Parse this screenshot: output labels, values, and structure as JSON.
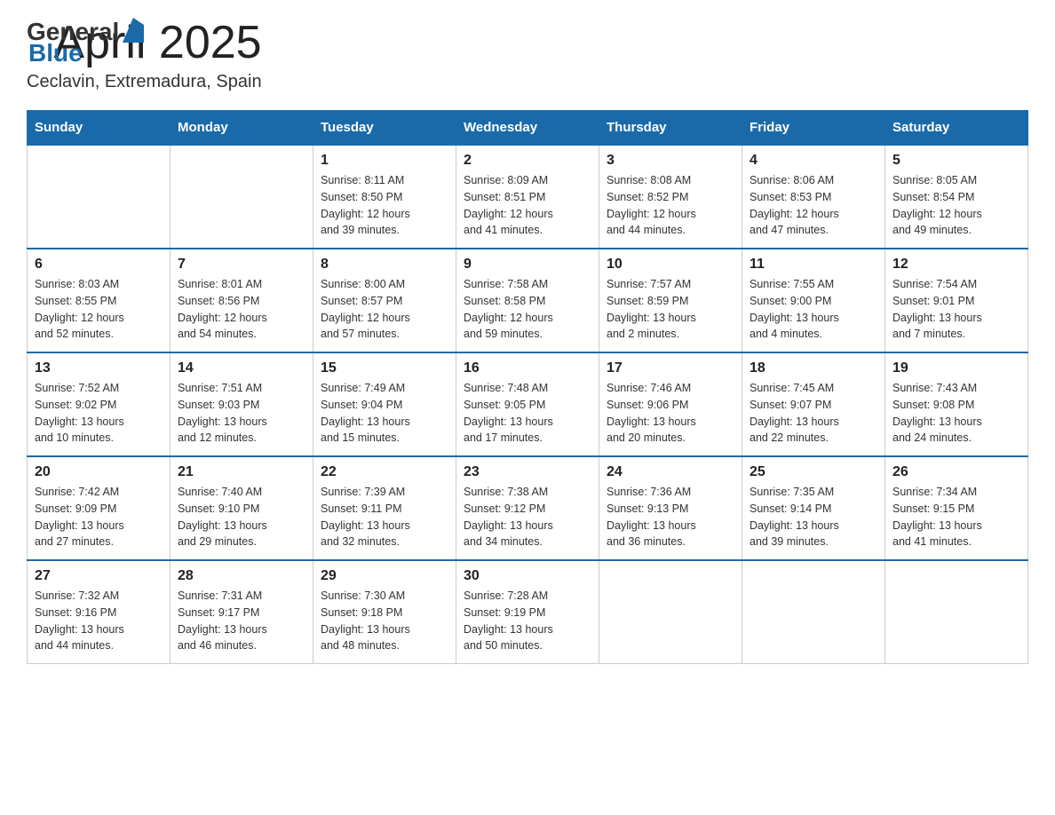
{
  "header": {
    "logo_general": "General",
    "logo_blue": "Blue",
    "month_year": "April 2025",
    "location": "Ceclavin, Extremadura, Spain"
  },
  "days_of_week": [
    "Sunday",
    "Monday",
    "Tuesday",
    "Wednesday",
    "Thursday",
    "Friday",
    "Saturday"
  ],
  "weeks": [
    [
      {
        "day": "",
        "info": ""
      },
      {
        "day": "",
        "info": ""
      },
      {
        "day": "1",
        "info": "Sunrise: 8:11 AM\nSunset: 8:50 PM\nDaylight: 12 hours\nand 39 minutes."
      },
      {
        "day": "2",
        "info": "Sunrise: 8:09 AM\nSunset: 8:51 PM\nDaylight: 12 hours\nand 41 minutes."
      },
      {
        "day": "3",
        "info": "Sunrise: 8:08 AM\nSunset: 8:52 PM\nDaylight: 12 hours\nand 44 minutes."
      },
      {
        "day": "4",
        "info": "Sunrise: 8:06 AM\nSunset: 8:53 PM\nDaylight: 12 hours\nand 47 minutes."
      },
      {
        "day": "5",
        "info": "Sunrise: 8:05 AM\nSunset: 8:54 PM\nDaylight: 12 hours\nand 49 minutes."
      }
    ],
    [
      {
        "day": "6",
        "info": "Sunrise: 8:03 AM\nSunset: 8:55 PM\nDaylight: 12 hours\nand 52 minutes."
      },
      {
        "day": "7",
        "info": "Sunrise: 8:01 AM\nSunset: 8:56 PM\nDaylight: 12 hours\nand 54 minutes."
      },
      {
        "day": "8",
        "info": "Sunrise: 8:00 AM\nSunset: 8:57 PM\nDaylight: 12 hours\nand 57 minutes."
      },
      {
        "day": "9",
        "info": "Sunrise: 7:58 AM\nSunset: 8:58 PM\nDaylight: 12 hours\nand 59 minutes."
      },
      {
        "day": "10",
        "info": "Sunrise: 7:57 AM\nSunset: 8:59 PM\nDaylight: 13 hours\nand 2 minutes."
      },
      {
        "day": "11",
        "info": "Sunrise: 7:55 AM\nSunset: 9:00 PM\nDaylight: 13 hours\nand 4 minutes."
      },
      {
        "day": "12",
        "info": "Sunrise: 7:54 AM\nSunset: 9:01 PM\nDaylight: 13 hours\nand 7 minutes."
      }
    ],
    [
      {
        "day": "13",
        "info": "Sunrise: 7:52 AM\nSunset: 9:02 PM\nDaylight: 13 hours\nand 10 minutes."
      },
      {
        "day": "14",
        "info": "Sunrise: 7:51 AM\nSunset: 9:03 PM\nDaylight: 13 hours\nand 12 minutes."
      },
      {
        "day": "15",
        "info": "Sunrise: 7:49 AM\nSunset: 9:04 PM\nDaylight: 13 hours\nand 15 minutes."
      },
      {
        "day": "16",
        "info": "Sunrise: 7:48 AM\nSunset: 9:05 PM\nDaylight: 13 hours\nand 17 minutes."
      },
      {
        "day": "17",
        "info": "Sunrise: 7:46 AM\nSunset: 9:06 PM\nDaylight: 13 hours\nand 20 minutes."
      },
      {
        "day": "18",
        "info": "Sunrise: 7:45 AM\nSunset: 9:07 PM\nDaylight: 13 hours\nand 22 minutes."
      },
      {
        "day": "19",
        "info": "Sunrise: 7:43 AM\nSunset: 9:08 PM\nDaylight: 13 hours\nand 24 minutes."
      }
    ],
    [
      {
        "day": "20",
        "info": "Sunrise: 7:42 AM\nSunset: 9:09 PM\nDaylight: 13 hours\nand 27 minutes."
      },
      {
        "day": "21",
        "info": "Sunrise: 7:40 AM\nSunset: 9:10 PM\nDaylight: 13 hours\nand 29 minutes."
      },
      {
        "day": "22",
        "info": "Sunrise: 7:39 AM\nSunset: 9:11 PM\nDaylight: 13 hours\nand 32 minutes."
      },
      {
        "day": "23",
        "info": "Sunrise: 7:38 AM\nSunset: 9:12 PM\nDaylight: 13 hours\nand 34 minutes."
      },
      {
        "day": "24",
        "info": "Sunrise: 7:36 AM\nSunset: 9:13 PM\nDaylight: 13 hours\nand 36 minutes."
      },
      {
        "day": "25",
        "info": "Sunrise: 7:35 AM\nSunset: 9:14 PM\nDaylight: 13 hours\nand 39 minutes."
      },
      {
        "day": "26",
        "info": "Sunrise: 7:34 AM\nSunset: 9:15 PM\nDaylight: 13 hours\nand 41 minutes."
      }
    ],
    [
      {
        "day": "27",
        "info": "Sunrise: 7:32 AM\nSunset: 9:16 PM\nDaylight: 13 hours\nand 44 minutes."
      },
      {
        "day": "28",
        "info": "Sunrise: 7:31 AM\nSunset: 9:17 PM\nDaylight: 13 hours\nand 46 minutes."
      },
      {
        "day": "29",
        "info": "Sunrise: 7:30 AM\nSunset: 9:18 PM\nDaylight: 13 hours\nand 48 minutes."
      },
      {
        "day": "30",
        "info": "Sunrise: 7:28 AM\nSunset: 9:19 PM\nDaylight: 13 hours\nand 50 minutes."
      },
      {
        "day": "",
        "info": ""
      },
      {
        "day": "",
        "info": ""
      },
      {
        "day": "",
        "info": ""
      }
    ]
  ]
}
